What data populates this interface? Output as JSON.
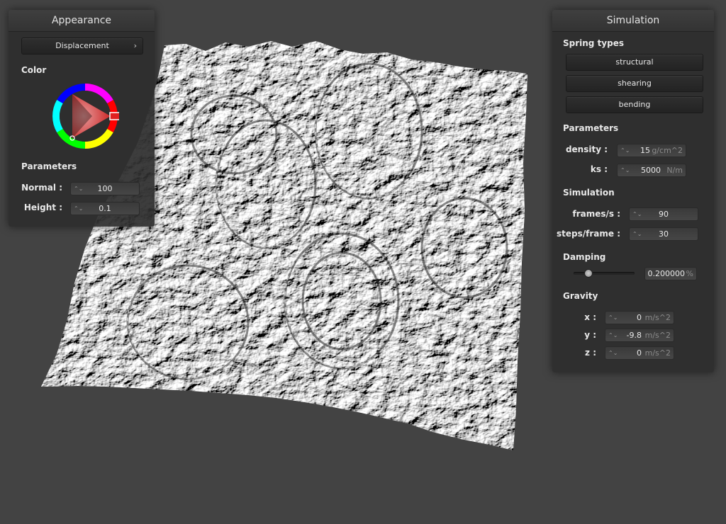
{
  "appearance": {
    "title": "Appearance",
    "shader_combo": "Displacement",
    "color_label": "Color",
    "parameters_label": "Parameters",
    "normal_label": "Normal :",
    "normal_value": "100",
    "height_label": "Height :",
    "height_value": "0.1"
  },
  "simulation": {
    "title": "Simulation",
    "spring_types_label": "Spring types",
    "structural_label": "structural",
    "shearing_label": "shearing",
    "bending_label": "bending",
    "parameters_label": "Parameters",
    "density_label": "density :",
    "density_value": "15",
    "density_unit": "g/cm^2",
    "ks_label": "ks :",
    "ks_value": "5000",
    "ks_unit": "N/m",
    "simulation_label": "Simulation",
    "fps_label": "frames/s :",
    "fps_value": "90",
    "steps_label": "steps/frame :",
    "steps_value": "30",
    "damping_label": "Damping",
    "damping_slider_fraction": 0.2,
    "damping_value": "0.200000",
    "damping_unit": "%",
    "gravity_label": "Gravity",
    "gx_label": "x :",
    "gx_value": "0",
    "gy_label": "y :",
    "gy_value": "-9.8",
    "gz_label": "z :",
    "gz_value": "0",
    "gravity_unit": "m/s^2"
  },
  "colors": {
    "background": "#434343",
    "panel": "#2e2e2e",
    "selected_color": "#e02020"
  }
}
